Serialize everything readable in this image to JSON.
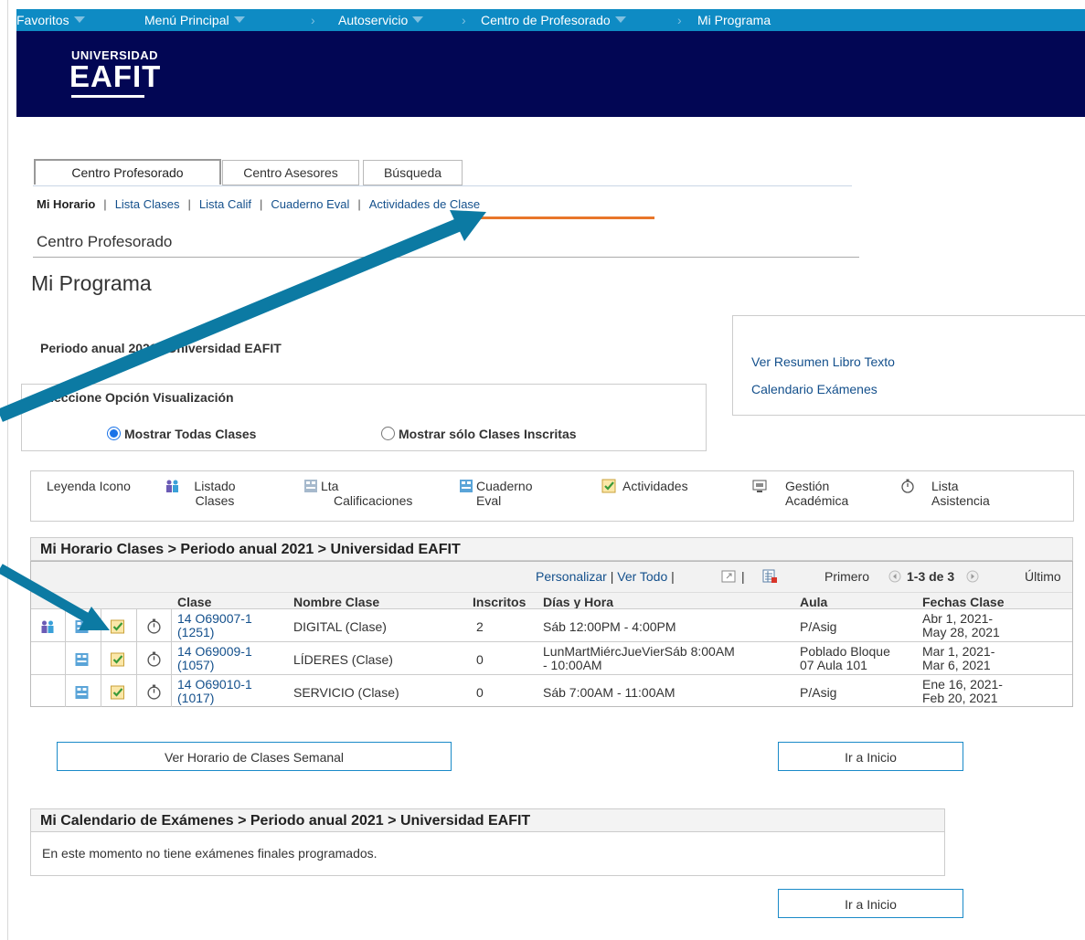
{
  "topnav": {
    "favoritos": "Favoritos",
    "menu": "Menú Principal",
    "autoservicio": "Autoservicio",
    "centro": "Centro de Profesorado",
    "programa": "Mi Programa"
  },
  "brand": {
    "top": "UNIVERSIDAD",
    "main": "EAFIT"
  },
  "tabs": [
    "Centro Profesorado",
    "Centro Asesores",
    "Búsqueda"
  ],
  "subnav": {
    "current": "Mi Horario",
    "links": [
      "Lista Clases",
      "Lista Calif",
      "Cuaderno Eval",
      "Actividades de Clase"
    ]
  },
  "section_title": "Centro Profesorado",
  "page_title": "Mi Programa",
  "period": "Periodo anual 2021 | Universidad EAFIT",
  "side_links": [
    "Ver Resumen Libro Texto",
    "Calendario Exámenes"
  ],
  "view_option": {
    "label": "Seleccione Opción Visualización",
    "radio_all": "Mostrar Todas Clases",
    "radio_enrolled": "Mostrar sólo Clases Inscritas"
  },
  "legend": {
    "title": "Leyenda Icono",
    "items": [
      {
        "l1": "Listado",
        "l2": "Clases"
      },
      {
        "l1": "Lta",
        "l2": "Calificaciones"
      },
      {
        "l1": "Cuaderno",
        "l2": "Eval"
      },
      {
        "l1": "Actividades",
        "l2": ""
      },
      {
        "l1": "Gestión",
        "l2": "Académica"
      },
      {
        "l1": "Lista",
        "l2": "Asistencia"
      }
    ]
  },
  "schedule": {
    "title": "Mi Horario Clases > Periodo anual 2021 > Universidad EAFIT",
    "personalizar": "Personalizar",
    "ver_todo": "Ver Todo",
    "primero": "Primero",
    "range": "1-3 de 3",
    "ultimo": "Último",
    "headers": [
      "Clase",
      "Nombre Clase",
      "Inscritos",
      "Días y Hora",
      "Aula",
      "Fechas Clase"
    ],
    "rows": [
      {
        "clase1": "14 O69007-1",
        "clase2": "(1251)",
        "nombre": "DIGITAL (Clase)",
        "inscritos": "2",
        "dias1": "Sáb 12:00PM - 4:00PM",
        "dias2": "",
        "aula1": "P/Asig",
        "aula2": "",
        "fecha1": "Abr 1, 2021-",
        "fecha2": "May 28, 2021"
      },
      {
        "clase1": "14 O69009-1",
        "clase2": "(1057)",
        "nombre": "LÍDERES (Clase)",
        "inscritos": "0",
        "dias1": "LunMartMiércJueVierSáb 8:00AM",
        "dias2": "- 10:00AM",
        "aula1": "Poblado Bloque",
        "aula2": "07 Aula 101",
        "fecha1": "Mar 1, 2021-",
        "fecha2": "Mar 6, 2021"
      },
      {
        "clase1": "14 O69010-1",
        "clase2": "(1017)",
        "nombre": "SERVICIO (Clase)",
        "inscritos": "0",
        "dias1": "Sáb 7:00AM - 11:00AM",
        "dias2": "",
        "aula1": "P/Asig",
        "aula2": "",
        "fecha1": "Ene 16, 2021-",
        "fecha2": "Feb 20, 2021"
      }
    ]
  },
  "buttons": {
    "weekly": "Ver Horario de Clases Semanal",
    "home": "Ir a Inicio"
  },
  "exams": {
    "title": "Mi Calendario de Exámenes > Periodo anual 2021 > Universidad EAFIT",
    "empty": "En este momento no tiene exámenes finales programados."
  },
  "colors": {
    "nav": "#0e8bc4",
    "banner": "#020654",
    "link": "#14508c",
    "arrow": "#0c7aa3",
    "highlight": "#e8762a"
  }
}
